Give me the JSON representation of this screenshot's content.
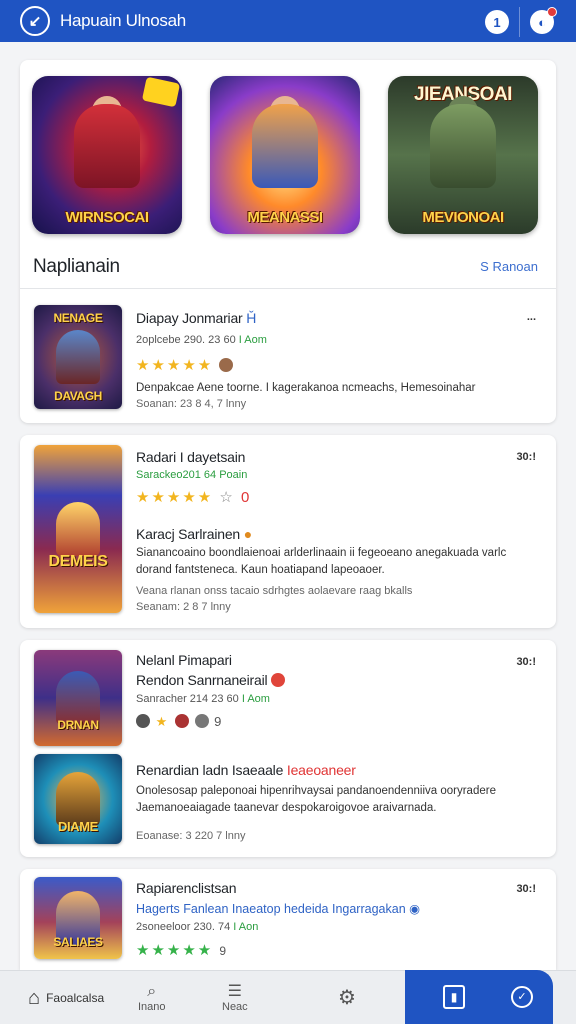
{
  "header": {
    "title": "Hapuain Ulnosah",
    "back_icon": "back-icon",
    "icons": [
      "account-icon",
      "notification-icon"
    ]
  },
  "featured": {
    "items": [
      {
        "caption": "WIRNSOCAI",
        "top": ""
      },
      {
        "caption": "MEANASSI",
        "top": ""
      },
      {
        "caption": "MEVIONOAI",
        "top": "JIEANSOAI"
      }
    ],
    "section_title": "Naplianain",
    "section_link": "S Ranoan"
  },
  "list": [
    {
      "thumb_top": "NENAGE",
      "thumb_bottom": "DAVAGH",
      "name": "Diapay Jonmariar",
      "name_suffix": "Ȟ",
      "meta": "2oplcebe 290. 23 60",
      "meta_tag": "I Aom",
      "stars": "★★★★★",
      "desc": "Denpakcae Aene toorne. I kagerakanoa ncmeachs, Hemesoinahar",
      "sub": "Soanan: 23 8  4, 7 lnny",
      "more": "..."
    },
    {
      "thumb_top": "",
      "thumb_bottom": "DEMEIS",
      "name": "Radari I dayetsain",
      "meta": "Sarackeo201 64",
      "meta_tag": "Poain",
      "stars": "★★★★★",
      "rating_extra": "☆ 0",
      "subtitle": "Karacj Sarlrainen",
      "desc": "Sianancoaino boondlaienoai arlderlinaain ii fegeoeano anegakuada varlc dorand fantsteneca. Kaun hoatiapand lapeoaoer.",
      "sub1": "Veana rlanan onss tacaio sdrhgtes aolaevare raag bkalls",
      "sub2": "Seanam: 2 8  7 lnny",
      "more": "30:!"
    },
    {
      "thumb_top": "",
      "thumb_bottom": "DRNAN",
      "thumb2_bottom": "DIAME",
      "name": "Nelanl Pimapari",
      "name2": "Rendon Sanrnaneirail",
      "meta": "Sanracher 214 23 60",
      "meta_tag": "I Aom",
      "stars": "★",
      "rating_extra": "9",
      "subtitle": "Renardian ladn Isaeaale",
      "subtitle_tag": "Ieaeoaneer",
      "desc": "Onolesosap paleponoai hipenrihvaysai pandanoendenniiva ooryradere Jaemanoeaiagade taanevar despokaroigovoe araivarnada.",
      "sub": "Eoanase: 3 220  7 lnny",
      "more": "30:!"
    },
    {
      "thumb_top": "",
      "thumb_bottom": "SALIAES",
      "name": "Rapiarenclistsan",
      "link": "Hagerts Fanlean Inaeatop hedeida Ingarragakan",
      "meta": "2soneeloor 230. 74",
      "meta_tag": "I Aon",
      "stars": "★★★★★",
      "rating_extra": "9",
      "more": "30:!"
    }
  ],
  "bottom_nav": [
    {
      "label": "Faoalcalsa",
      "icon": "home-icon"
    },
    {
      "label": "Inano",
      "icon": "search-icon"
    },
    {
      "label": "Neac",
      "icon": "list-icon"
    },
    {
      "label": "",
      "icon": "settings-icon"
    },
    {
      "label": "",
      "icon": "library-icon"
    },
    {
      "label": "",
      "icon": "clock-icon"
    }
  ],
  "colors": {
    "primary": "#1f54c2",
    "star": "#f2b51f",
    "green": "#2a9d3f",
    "link": "#2f63c5"
  }
}
